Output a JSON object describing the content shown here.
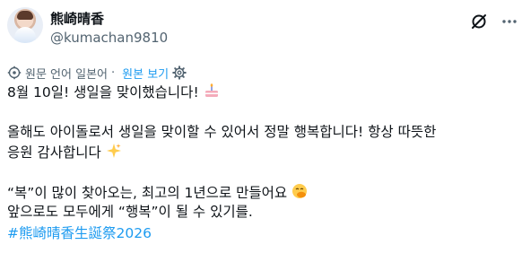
{
  "author": {
    "display_name": "熊崎晴香",
    "handle": "@kumachan9810"
  },
  "translation_bar": {
    "original_language": "원문 언어 일본어",
    "show_original": "원본 보기"
  },
  "post": {
    "line1": "8월 10일! 생일을 맞이했습니다!",
    "line2": "올해도 아이돌로서 생일을 맞이할 수 있어서 정말 행복합니다! 항상 따뜻한",
    "line3": "응원 감사합니다",
    "line4": "“복”이 많이 찾아오는, 최고의 1년으로 만들어요",
    "line5": "앞으로도 모두에게 “행복”이 될 수 있기를.",
    "hashtag": "#熊崎晴香生誕祭2026"
  },
  "colors": {
    "text": "#0f1419",
    "secondary": "#536471",
    "link": "#1d9bf0"
  },
  "icons": [
    "grok-icon",
    "more-icon",
    "globe-gear-icon",
    "gear-icon",
    "birthday-cake-emoji",
    "sparkles-emoji",
    "hand-over-mouth-emoji"
  ]
}
